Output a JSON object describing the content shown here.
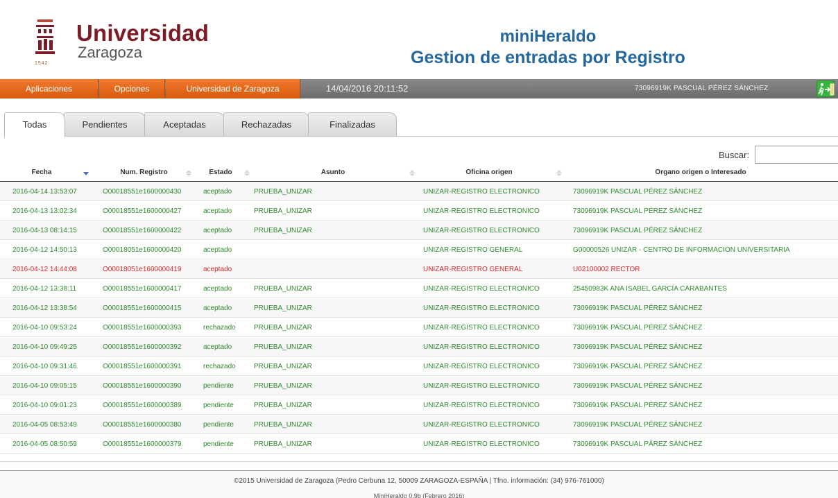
{
  "header": {
    "logo_university": "Universidad",
    "logo_city": "Zaragoza",
    "logo_year": "1542",
    "app_name": "miniHeraldo",
    "app_subtitle": "Gestion de entradas por Registro"
  },
  "navbar": {
    "menu": [
      "Aplicaciones",
      "Opciones",
      "Universidad de Zaragoza"
    ],
    "datetime": "14/04/2016 20:11:52",
    "user": "73096919K PASCUAL PÉREZ SÁNCHEZ",
    "accent": "#e8661a"
  },
  "tabs": [
    "Todas",
    "Pendientes",
    "Aceptadas",
    "Rechazadas",
    "Finalizadas"
  ],
  "active_tab": "Todas",
  "search": {
    "label": "Buscar:",
    "value": ""
  },
  "table": {
    "columns": [
      "Fecha",
      "Num. Registro",
      "Estado",
      "Asunto",
      "Oficina origen",
      "Organo origen o Interesado"
    ],
    "sorted_column": "Fecha",
    "rows": [
      [
        "2016-04-14 13:53:07",
        "O00018551e1600000430",
        "aceptado",
        "PRUEBA_UNIZAR",
        "UNIZAR-REGISTRO ELECTRONICO",
        "73096919K PASCUAL PÉREZ SÁNCHEZ"
      ],
      [
        "2016-04-13 13:02:34",
        "O00018551e1600000427",
        "aceptado",
        "PRUEBA_UNIZAR",
        "UNIZAR-REGISTRO ELECTRONICO",
        "73096919K PASCUAL PÉREZ SÁNCHEZ"
      ],
      [
        "2016-04-13 08:14:15",
        "O00018551e1600000422",
        "aceptado",
        "PRUEBA_UNIZAR",
        "UNIZAR-REGISTRO ELECTRONICO",
        "73096919K PASCUAL PÉREZ SÁNCHEZ"
      ],
      [
        "2016-04-12 14:50:13",
        "O00018051e1600000420",
        "aceptado",
        "",
        "UNIZAR-REGISTRO GENERAL",
        "G00000526 UNIZAR - CENTRO DE INFORMACION UNIVERSITARIA"
      ],
      [
        "2016-04-12 14:44:08",
        "O00018051e1600000419",
        "aceptado",
        "",
        "UNIZAR-REGISTRO GENERAL",
        "U02100002 RECTOR"
      ],
      [
        "2016-04-12 13:38:11",
        "O00018551e1600000417",
        "aceptado",
        "PRUEBA_UNIZAR",
        "UNIZAR-REGISTRO ELECTRONICO",
        "25450983K ANA ISABEL GARCÍA CARABANTES"
      ],
      [
        "2016-04-12 13:38:54",
        "O00018551e1600000415",
        "aceptado",
        "PRUEBA_UNIZAR",
        "UNIZAR-REGISTRO ELECTRONICO",
        "73096919K PASCUAL PÉREZ SÁNCHEZ"
      ],
      [
        "2016-04-10 09:53:24",
        "O00018551e1600000393",
        "rechazado",
        "PRUEBA_UNIZAR",
        "UNIZAR-REGISTRO ELECTRONICO",
        "73096919K PASCUAL PÉREZ SÁNCHEZ"
      ],
      [
        "2016-04-10 09:49:25",
        "O00018551e1600000392",
        "aceptado",
        "PRUEBA_UNIZAR",
        "UNIZAR-REGISTRO ELECTRONICO",
        "73096919K PASCUAL PÉREZ SÁNCHEZ"
      ],
      [
        "2016-04-10 09:31:46",
        "O00018551e1600000391",
        "rechazado",
        "PRUEBA_UNIZAR",
        "UNIZAR-REGISTRO ELECTRONICO",
        "73096919K PASCUAL PÉREZ SÁNCHEZ"
      ],
      [
        "2016-04-10 09:05:15",
        "O00018551e1600000390",
        "pendiente",
        "PRUEBA_UNIZAR",
        "UNIZAR-REGISTRO ELECTRONICO",
        "73096919K PASCUAL PÉREZ SÁNCHEZ"
      ],
      [
        "2016-04-10 09:01:23",
        "O00018551e1600000389",
        "pendiente",
        "PRUEBA_UNIZAR",
        "UNIZAR-REGISTRO ELECTRONICO",
        "73096919K PASCUAL PÉREZ SÁNCHEZ"
      ],
      [
        "2016-04-05 08:53:49",
        "O00018551e1600000380",
        "pendiente",
        "PRUEBA_UNIZAR",
        "UNIZAR-REGISTRO ELECTRONICO",
        "73096919K PASCUAL PÉREZ SÁNCHEZ"
      ],
      [
        "2016-04-05 08:50:59",
        "O00018551e1600000379",
        "pendiente",
        "PRUEBA_UNIZAR",
        "UNIZAR-REGISTRO ELECTRONICO",
        "73096919K PASCUAL PÂREZ SÁNCHEZ"
      ]
    ],
    "highlight_row": 4,
    "row_color": "#2e8b2e",
    "highlight_color": "#d42a2a"
  },
  "footer": {
    "text": "©2015 Universidad de Zaragoza (Pedro Cerbuna 12, 50009 ZARAGOZA-ESPAÑA | Tfno. información: (34) 976-761000)",
    "version": "MiniHeraldo 0.9b (Febrero 2016)"
  }
}
